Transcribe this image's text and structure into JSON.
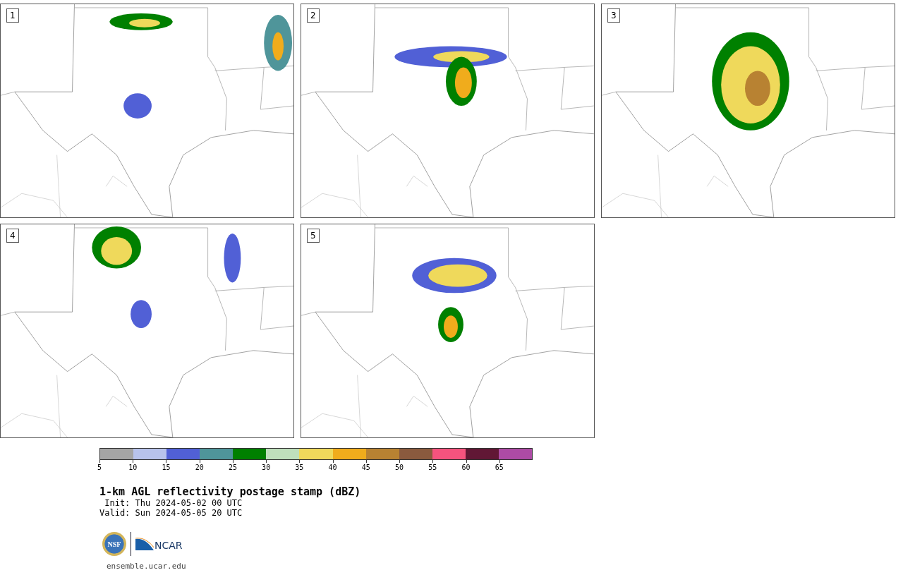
{
  "panels": [
    {
      "label": "1"
    },
    {
      "label": "2"
    },
    {
      "label": "3"
    },
    {
      "label": "4"
    },
    {
      "label": "5"
    }
  ],
  "colorbar": {
    "segments": [
      {
        "color": "#a5a5a5"
      },
      {
        "color": "#b8c3ec"
      },
      {
        "color": "#5160d6"
      },
      {
        "color": "#4f959a"
      },
      {
        "color": "#008000"
      },
      {
        "color": "#bfdfbc"
      },
      {
        "color": "#efd95b"
      },
      {
        "color": "#f0ac1c"
      },
      {
        "color": "#b88232"
      },
      {
        "color": "#8a5a3e"
      },
      {
        "color": "#f5537e"
      },
      {
        "color": "#611735"
      },
      {
        "color": "#ad4ba5"
      }
    ],
    "ticks": [
      "5",
      "10",
      "15",
      "20",
      "25",
      "30",
      "35",
      "40",
      "45",
      "50",
      "55",
      "60",
      "65"
    ]
  },
  "title": "1-km AGL reflectivity postage stamp (dBZ)",
  "init": "Init: Thu 2024-05-02 00 UTC",
  "valid": "Valid: Sun 2024-05-05 20 UTC",
  "logos": {
    "left": "NSF",
    "right": "NCAR"
  },
  "link": "ensemble.ucar.edu"
}
